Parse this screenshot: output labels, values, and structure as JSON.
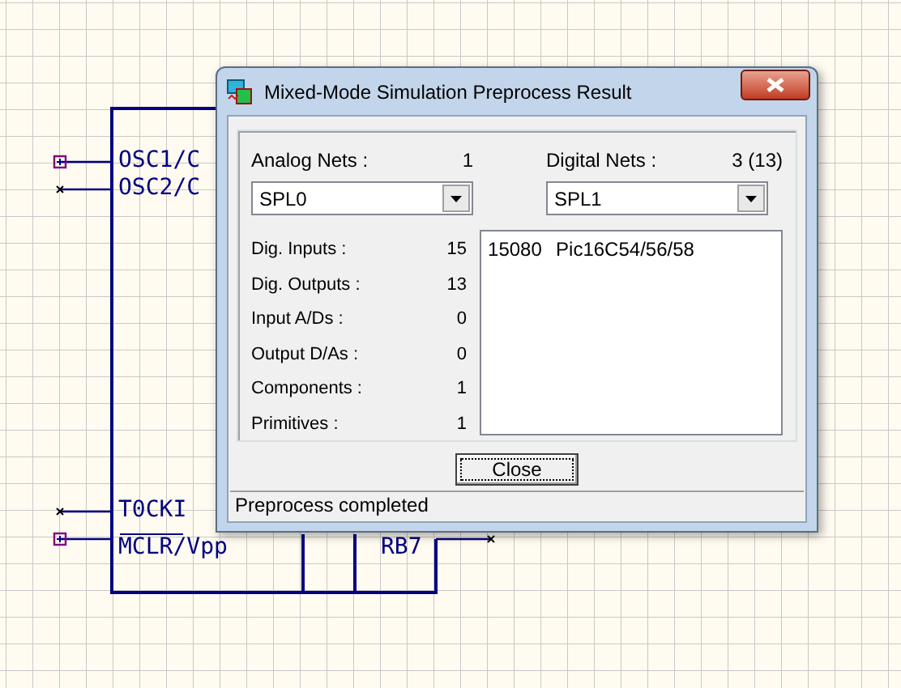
{
  "canvas": {
    "pins": [
      {
        "label": "OSC1/C",
        "kind": "box",
        "overline": false
      },
      {
        "label": "OSC2/C",
        "kind": "cross",
        "overline": false
      },
      {
        "label": "T0CKI",
        "kind": "cross",
        "overline": false
      },
      {
        "label": "MCLR/Vpp",
        "kind": "box",
        "overline": true
      },
      {
        "label": "RB7",
        "kind": "cross",
        "overline": false
      }
    ]
  },
  "dialog": {
    "title": "Mixed-Mode Simulation Preprocess Result",
    "analog_nets": {
      "label": "Analog Nets :",
      "value": "1",
      "selection": "SPL0"
    },
    "digital_nets": {
      "label": "Digital Nets :",
      "value": "3 (13)",
      "selection": "SPL1"
    },
    "stats": [
      {
        "label": "Dig. Inputs :",
        "value": "15"
      },
      {
        "label": "Dig. Outputs :",
        "value": "13"
      },
      {
        "label": "Input A/Ds :",
        "value": "0"
      },
      {
        "label": "Output D/As :",
        "value": "0"
      },
      {
        "label": "Components :",
        "value": "1"
      },
      {
        "label": "Primitives :",
        "value": "1"
      }
    ],
    "list_items": [
      {
        "id": "15080",
        "name": "Pic16C54/56/58"
      }
    ],
    "close_button": "Close",
    "status_bar": "Preprocess completed"
  }
}
